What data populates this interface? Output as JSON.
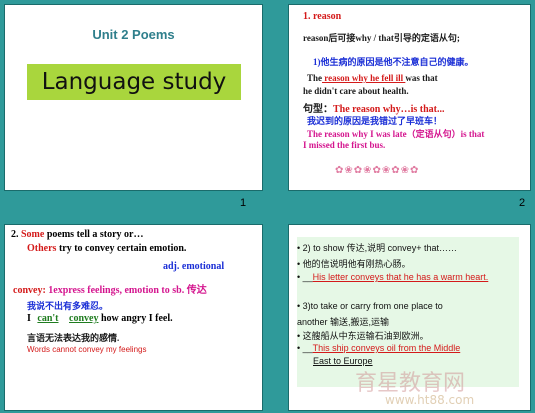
{
  "slides": {
    "s1": {
      "title": "Unit 2  Poems",
      "band": "Language study",
      "number": "1"
    },
    "s2": {
      "number": "2",
      "heading": "1.  reason",
      "intro": "reason后可接why / that引导的定语从句;",
      "ex1": "1)他生病的原因是他不注意自己的健康。",
      "l1a": "The",
      "l1b": " reason   why    he      fell      ill ",
      "l1c": "was that",
      "l2": "he didn't care about health.",
      "pattern_label": "句型：",
      "pattern": "The reason why…is that...",
      "cn2": "我迟到的原因是我错过了早班车！",
      "l3": "The reason why I was late（定语从句）is that",
      "l4": "I missed the first bus.",
      "flowers": "✿❀✿❀✿❀✿❀✿"
    },
    "s3": {
      "l1_num": "2.",
      "l1_some": "Some",
      "l1_rest": " poems tell a story or…",
      "l2_others": "Others",
      "l2_rest": " try to convey certain emotion.",
      "l3_adj": "adj.",
      "l3_emo": "emotional",
      "l4_word": "convey:",
      "l4_rest": " 1express feelings, emotion to sb. 传达",
      "cn1": "我说不出有多难忍。",
      "l5_i": "I",
      "l5_cant": "can't",
      "l5_convey": "convey",
      "l5_rest": "how angry I feel.",
      "cn2": "言语无法表达我的感情.",
      "l6": "Words cannot convey my feelings"
    },
    "s4": {
      "b1": "• 2) to show 传达,说明     convey+ that……",
      "b2": "• 他的信说明他有刚热心肠。",
      "b3a": "• __",
      "b3b": "His letter conveys that he has a warm heart.",
      "b4": "• 3)to take or carry from one place to",
      "b4b": "   another 输送,搬运,运输",
      "b5": "• 这艘船从中东运输石油到欧洲。",
      "b6a": "• __",
      "b6b": "This ship conveys oil from the Middle",
      "b6c": "East to Europe",
      "wm1": "育星教育网",
      "wm2": "www.ht88.com"
    }
  }
}
